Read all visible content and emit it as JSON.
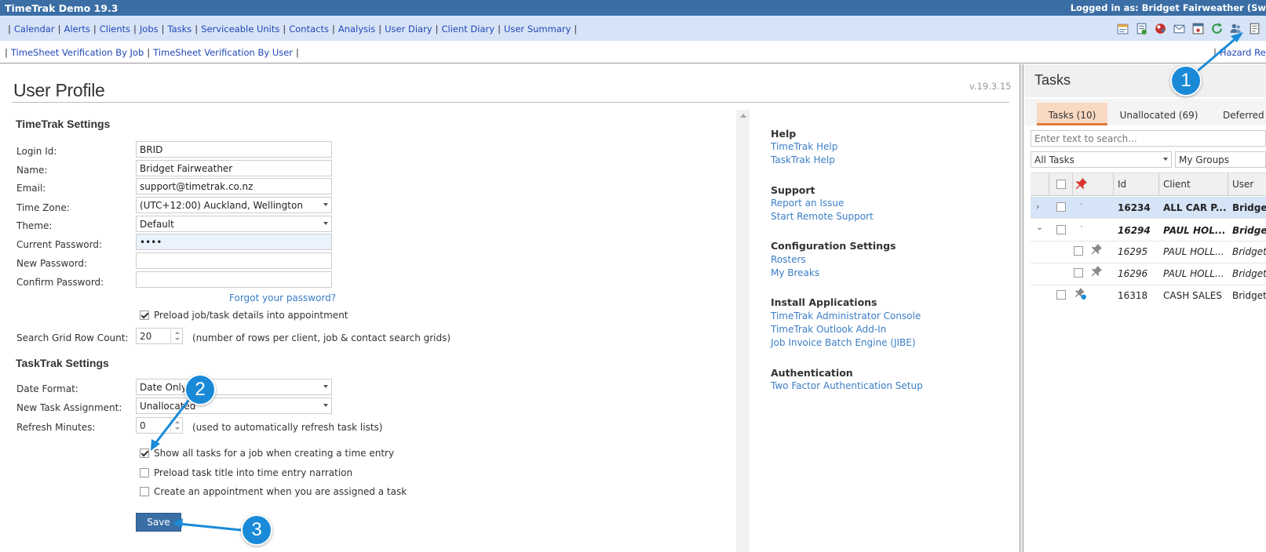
{
  "titlebar": {
    "app_name": "TimeTrak Demo 19.3",
    "login": "Logged in as: Bridget Fairweather (Sw"
  },
  "nav": {
    "items": [
      "Calendar",
      "Alerts",
      "Clients",
      "Jobs",
      "Tasks",
      "Serviceable Units",
      "Contacts",
      "Analysis",
      "User Diary",
      "Client Diary",
      "User Summary"
    ],
    "items2": [
      "TimeSheet Verification By Job",
      "TimeSheet Verification By User"
    ],
    "right_link": "Hazard Reg",
    "icons": [
      "schedule-icon",
      "report-icon",
      "alert-icon",
      "mail-icon",
      "window-icon",
      "refresh-icon",
      "user-profile-icon",
      "document-icon"
    ]
  },
  "page": {
    "title": "User Profile",
    "version": "v.19.3.15"
  },
  "timetrak": {
    "heading": "TimeTrak Settings",
    "login_label": "Login Id:",
    "login_value": "BRID",
    "name_label": "Name:",
    "name_value": "Bridget Fairweather",
    "email_label": "Email:",
    "email_value": "support@timetrak.co.nz",
    "tz_label": "Time Zone:",
    "tz_value": "(UTC+12:00) Auckland, Wellington",
    "theme_label": "Theme:",
    "theme_value": "Default",
    "curpw_label": "Current Password:",
    "curpw_value": "••••",
    "newpw_label": "New Password:",
    "confpw_label": "Confirm Password:",
    "forgot": "Forgot your password?",
    "preload_label": "Preload job/task details into appointment",
    "preload_checked": true,
    "grid_label": "Search Grid Row Count:",
    "grid_value": "20",
    "grid_note": "(number of rows per client, job & contact search grids)"
  },
  "tasktrak": {
    "heading": "TaskTrak Settings",
    "date_label": "Date Format:",
    "date_value": "Date Only",
    "assign_label": "New Task Assignment:",
    "assign_value": "Unallocated",
    "refresh_label": "Refresh Minutes:",
    "refresh_value": "0",
    "refresh_note": "(used to automatically refresh task lists)",
    "options": [
      {
        "label": "Show all tasks for a job when creating a time entry",
        "checked": true
      },
      {
        "label": "Preload task title into time entry narration",
        "checked": false
      },
      {
        "label": "Create an appointment when you are assigned a task",
        "checked": false
      }
    ],
    "save": "Save"
  },
  "side": {
    "help_h": "Help",
    "help1": "TimeTrak Help",
    "help2": "TaskTrak Help",
    "support_h": "Support",
    "support1": "Report an Issue",
    "support2": "Start Remote Support",
    "config_h": "Configuration Settings",
    "config1": "Rosters",
    "config2": "My Breaks",
    "install_h": "Install Applications",
    "install1": "TimeTrak Administrator Console",
    "install2": "TimeTrak Outlook Add-In",
    "install3": "Job Invoice Batch Engine (JIBE)",
    "auth_h": "Authentication",
    "auth1": "Two Factor Authentication Setup"
  },
  "tasks": {
    "title": "Tasks",
    "tabs": [
      "Tasks (10)",
      "Unallocated (69)",
      "Deferred"
    ],
    "search_placeholder": "Enter text to search...",
    "filter": "All Tasks",
    "groups": "My Groups",
    "cols": [
      "Id",
      "Client",
      "User"
    ],
    "rows": [
      {
        "id": "16234",
        "client": "ALL CAR P...",
        "user": "Bridge"
      },
      {
        "id": "16294",
        "client": "PAUL HOL...",
        "user": "Bridge"
      },
      {
        "id": "16295",
        "client": "PAUL HOLL...",
        "user": "Bridget"
      },
      {
        "id": "16296",
        "client": "PAUL HOLL...",
        "user": "Bridget"
      },
      {
        "id": "16318",
        "client": "CASH SALES",
        "user": "Bridget"
      }
    ]
  },
  "callouts": [
    "1",
    "2",
    "3"
  ],
  "colors": {
    "header": "#3a6ea5",
    "nav_bg": "#d7e4f7",
    "link": "#3b7ec7",
    "callout": "#1a8ad8",
    "active_tab": "#f9d9c1"
  }
}
